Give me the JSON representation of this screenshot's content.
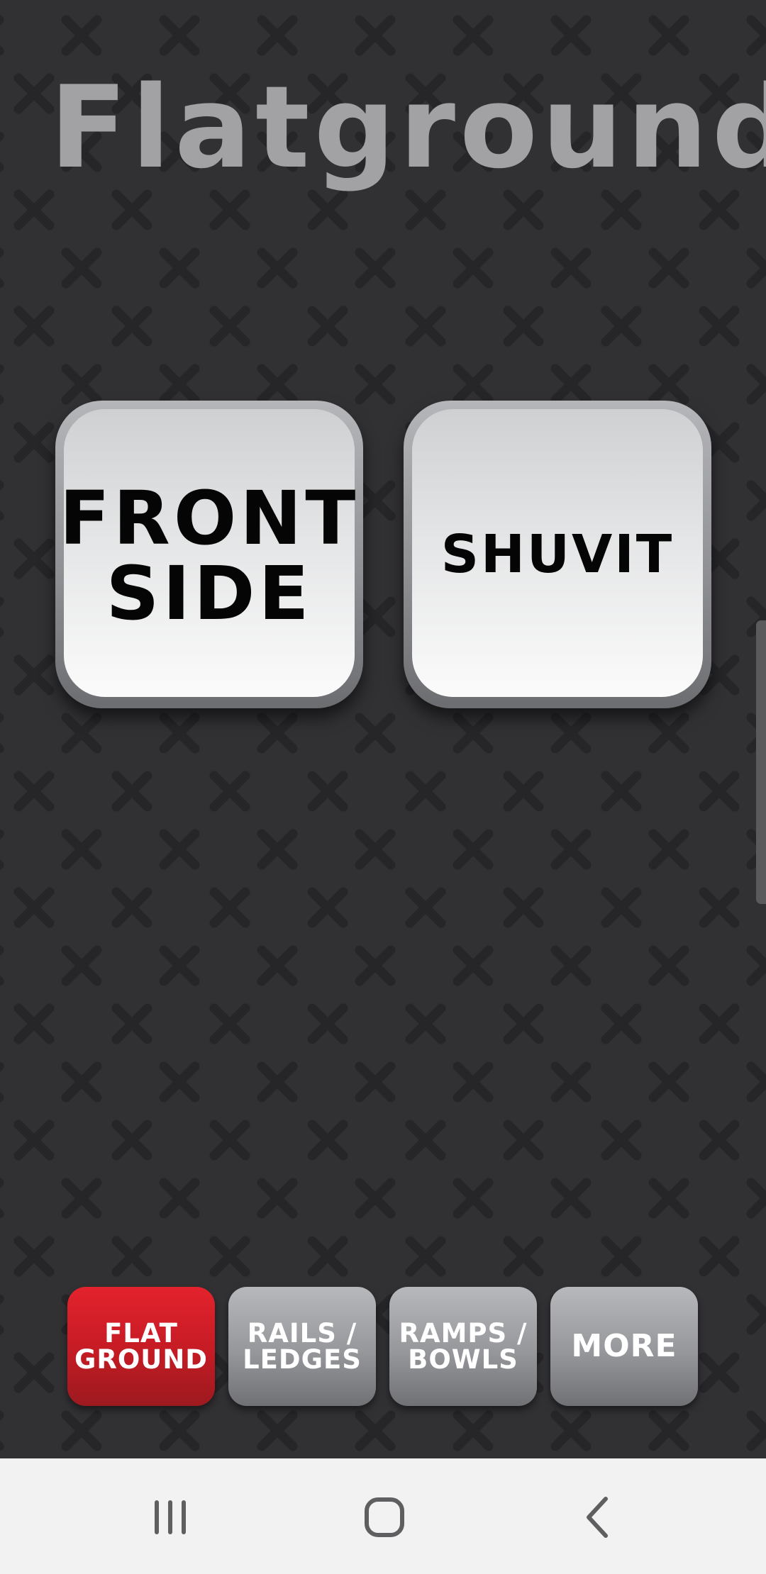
{
  "screen": {
    "title": "Flatground",
    "background_color": "#313033",
    "pattern_icon": "x-mark-icon"
  },
  "tricks": [
    {
      "label": "FRONT\nSIDE",
      "icon": null
    },
    {
      "label": "SHUVIT",
      "icon": null
    }
  ],
  "categories": [
    {
      "label": "FLAT\nGROUND",
      "active": true,
      "color": "#d81f28"
    },
    {
      "label": "RAILS /\nLEDGES",
      "active": false,
      "color": "#9a9b9f"
    },
    {
      "label": "RAMPS /\nBOWLS",
      "active": false,
      "color": "#9a9b9f"
    },
    {
      "label": "MORE",
      "active": false,
      "color": "#9a9b9f"
    }
  ],
  "system_nav": {
    "recents_icon": "recent-apps-icon",
    "home_icon": "home-icon",
    "back_icon": "back-icon",
    "background_color": "#f2f2f2"
  }
}
